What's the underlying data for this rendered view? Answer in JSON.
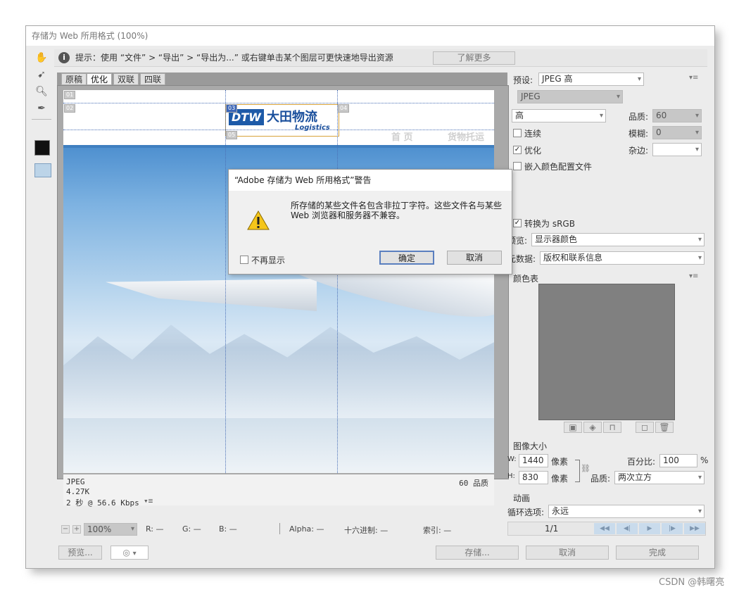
{
  "window": {
    "title": "存储为 Web 所用格式 (100%)"
  },
  "tip": {
    "text": "提示：使用 “文件” > “导出” > “导出为...” 或右键单击某个图层可更快速地导出资源",
    "learn_more": "了解更多"
  },
  "tabs": [
    "原稿",
    "优化",
    "双联",
    "四联"
  ],
  "image": {
    "logo_dtw": "DTW",
    "logo_cn": "大田物流",
    "logo_en": "Logistics",
    "nav": [
      "首 页",
      "货物托运"
    ],
    "slices": [
      "01",
      "02",
      "03",
      "04",
      "05"
    ]
  },
  "image_info": {
    "format": "JPEG",
    "size": "4.27K",
    "speed": "2 秒 @ 56.6 Kbps",
    "quality": "60 品质"
  },
  "status": {
    "zoom": "100%",
    "r": "R: —",
    "g": "G: —",
    "b": "B: —",
    "alpha": "Alpha: —",
    "hex": "十六进制: —",
    "index": "索引: —"
  },
  "settings": {
    "preset_label": "预设:",
    "preset_value": "JPEG 高",
    "format": "JPEG",
    "quality_level": "高",
    "quality_label": "品质:",
    "quality_value": "60",
    "progressive": "连续",
    "blur_label": "模糊:",
    "blur_value": "0",
    "optimized": "优化",
    "matte_label": "杂边:",
    "embed_profile": "嵌入颜色配置文件",
    "convert_srgb": "转换为 sRGB",
    "preview_label": "预览:",
    "preview_value": "显示器颜色",
    "metadata_label": "元数据:",
    "metadata_value": "版权和联系信息",
    "color_table": "颜色表",
    "image_size": "图像大小",
    "w_label": "W:",
    "w_value": "1440",
    "h_label": "H:",
    "h_value": "830",
    "px": "像素",
    "percent_label": "百分比:",
    "percent_value": "100",
    "percent_unit": "%",
    "resample_label": "品质:",
    "resample_value": "两次立方",
    "animation": "动画",
    "loop_label": "循环选项:",
    "loop_value": "永远",
    "frame": "1/1"
  },
  "dialog": {
    "title": "“Adobe 存储为 Web 所用格式”警告",
    "message": "所存储的某些文件名包含非拉丁字符。这些文件名与某些 Web 浏览器和服务器不兼容。",
    "dont_show": "不再显示",
    "ok": "确定",
    "cancel": "取消"
  },
  "buttons": {
    "preview": "预览...",
    "save": "存储...",
    "cancel": "取消",
    "done": "完成"
  },
  "watermark": "CSDN @韩曙亮"
}
